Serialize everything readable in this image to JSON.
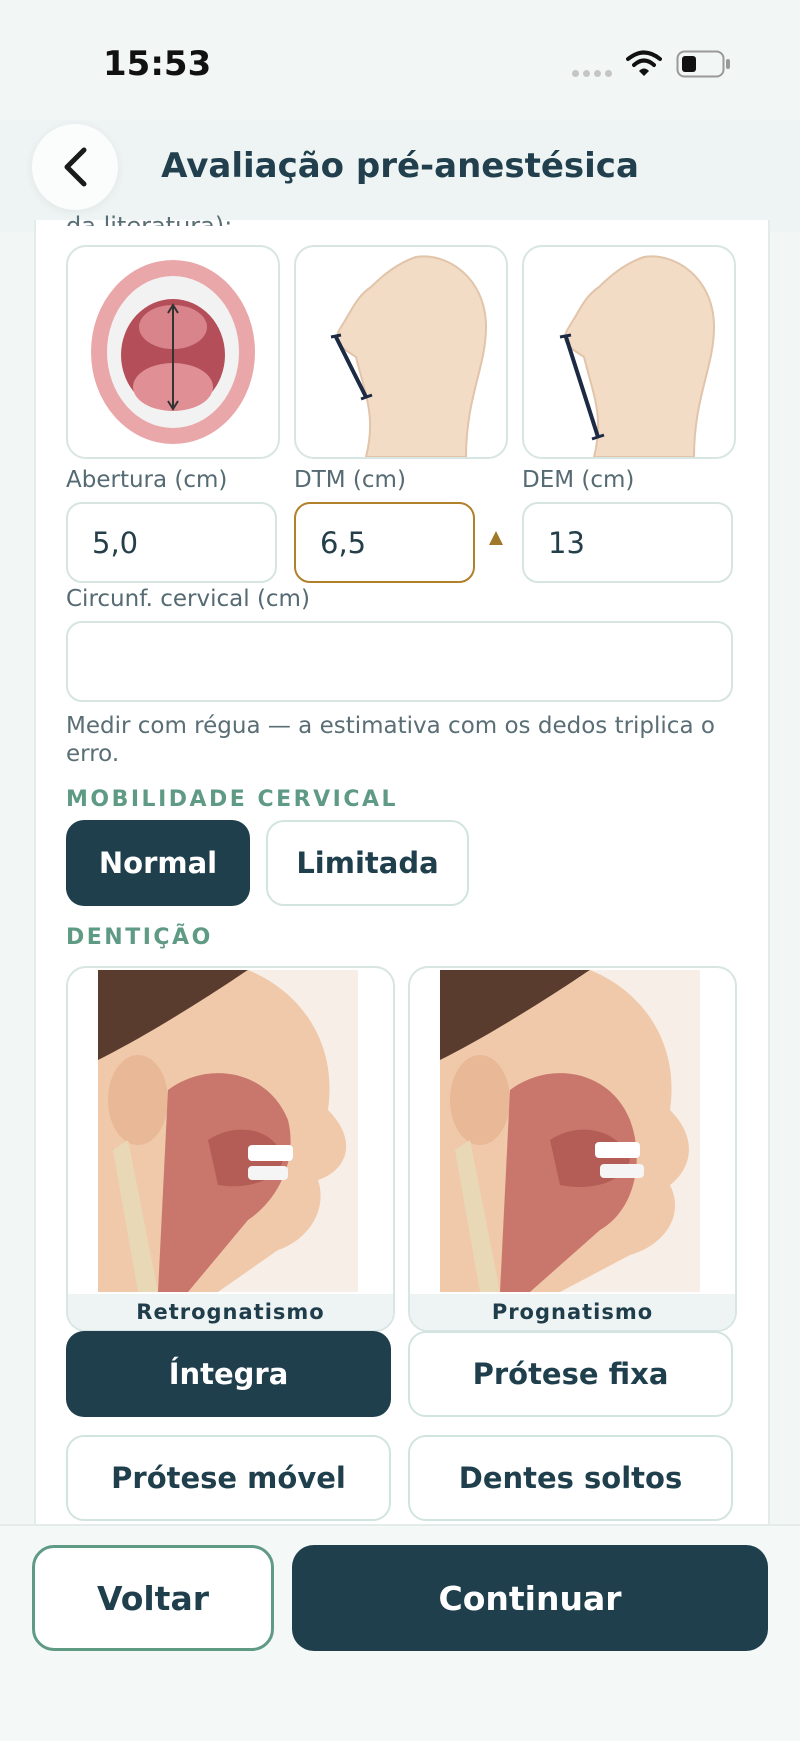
{
  "status": {
    "time": "15:53"
  },
  "header": {
    "title": "Avaliação pré-anestésica"
  },
  "airway": {
    "cut_text": "da literatura):",
    "measures": [
      {
        "label": "Abertura (cm)",
        "value": "5,0"
      },
      {
        "label": "DTM (cm)",
        "value": "6,5"
      },
      {
        "label": "DEM (cm)",
        "value": "13"
      }
    ],
    "cervical_label": "Circunf. cervical (cm)",
    "cervical_value": "",
    "hint": "Medir com régua — a estimativa com os dedos triplica o erro."
  },
  "mobility": {
    "title": "MOBILIDADE CERVICAL",
    "options": [
      "Normal",
      "Limitada"
    ],
    "selected": "Normal"
  },
  "dentition": {
    "title": "DENTIÇÃO",
    "images": [
      "Retrognatismo",
      "Prognatismo"
    ],
    "options": [
      "Íntegra",
      "Prótese fixa",
      "Prótese móvel",
      "Dentes soltos"
    ],
    "selected": "Íntegra"
  },
  "footer": {
    "back": "Voltar",
    "next": "Continuar"
  },
  "colors": {
    "primary": "#1f3f4c",
    "accent": "#5f9a85",
    "warning": "#a0782a"
  }
}
